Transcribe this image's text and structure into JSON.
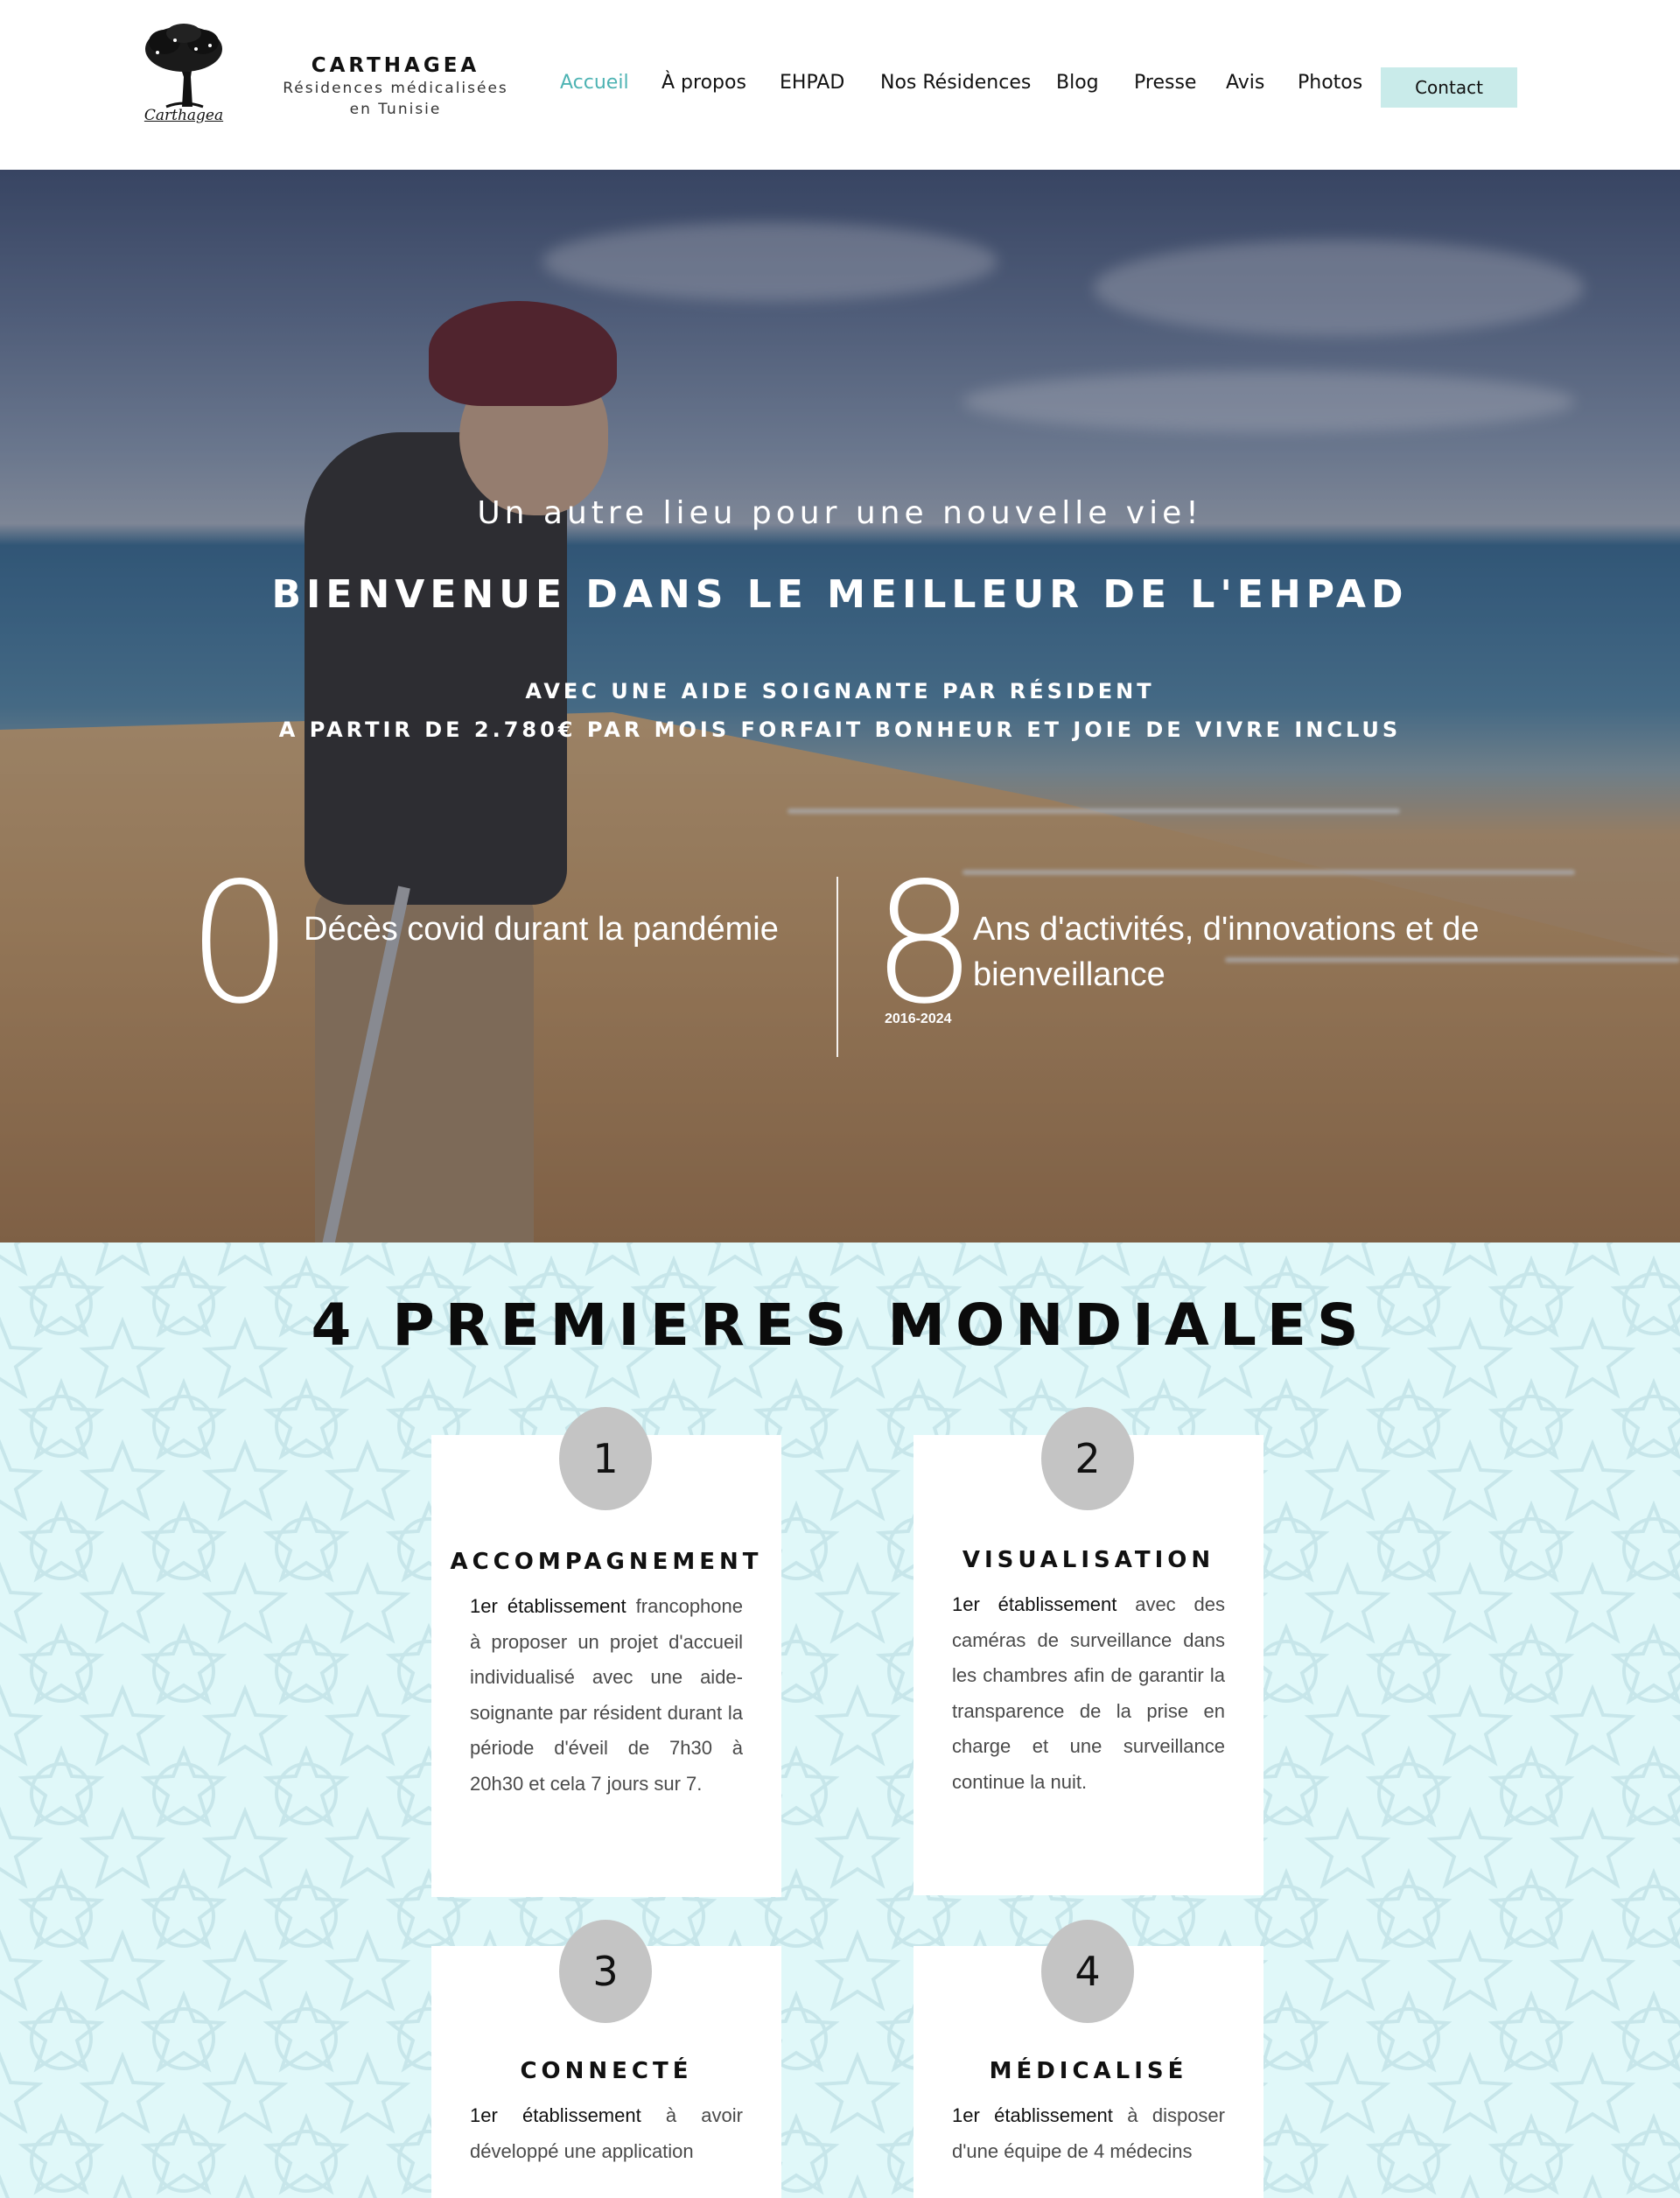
{
  "header": {
    "logo_text": "Carthagea",
    "brand_name": "CARTHAGEA",
    "brand_sub_line1": "Résidences médicalisées",
    "brand_sub_line2": "en Tunisie",
    "nav": {
      "accueil": "Accueil",
      "apropos": "À propos",
      "ehpad": "EHPAD",
      "residences": "Nos Résidences",
      "blog": "Blog",
      "presse": "Presse",
      "avis": "Avis",
      "photos": "Photos",
      "contact": "Contact"
    },
    "active_nav": "Accueil",
    "accent_color": "#4db3b3",
    "contact_bg": "#c9ebea"
  },
  "hero": {
    "tagline": "Un autre lieu pour une nouvelle vie!",
    "welcome": "BIENVENUE DANS LE MEILLEUR DE L'EHPAD",
    "sub1": "AVEC UNE AIDE SOIGNANTE PAR RÉSIDENT",
    "sub2": "A PARTIR DE 2.780€ PAR MOIS FORFAIT BONHEUR ET JOIE DE VIVRE INCLUS",
    "stat1": {
      "value": "0",
      "label": "Décès covid durant la pandémie"
    },
    "stat2": {
      "value": "8",
      "years": "2016-2024",
      "label_line1": "Ans d'activités, d'innovations et de",
      "label_line2": "bienveillance"
    }
  },
  "firsts": {
    "title": "4 PREMIERES MONDIALES",
    "bg_color": "#e0f8f9",
    "cards": [
      {
        "number": "1",
        "title": "ACCOMPAGNEMENT",
        "highlight": "1er établissement",
        "text": " francophone à proposer un projet d'accueil individualisé avec une aide-soignante par résident durant la période d'éveil de 7h30 à 20h30 et cela 7 jours sur 7."
      },
      {
        "number": "2",
        "title": "VISUALISATION",
        "highlight": "1er établissement",
        "text": " avec des caméras de surveillance dans les chambres afin de garantir la transparence de la prise en charge et une surveillance continue la nuit."
      },
      {
        "number": "3",
        "title": "CONNECTÉ",
        "highlight": "1er établissement",
        "text": " à avoir développé une application"
      },
      {
        "number": "4",
        "title": "MÉDICALISÉ",
        "highlight": "1er établissement",
        "text": " à disposer d'une équipe de 4 médecins"
      }
    ]
  }
}
